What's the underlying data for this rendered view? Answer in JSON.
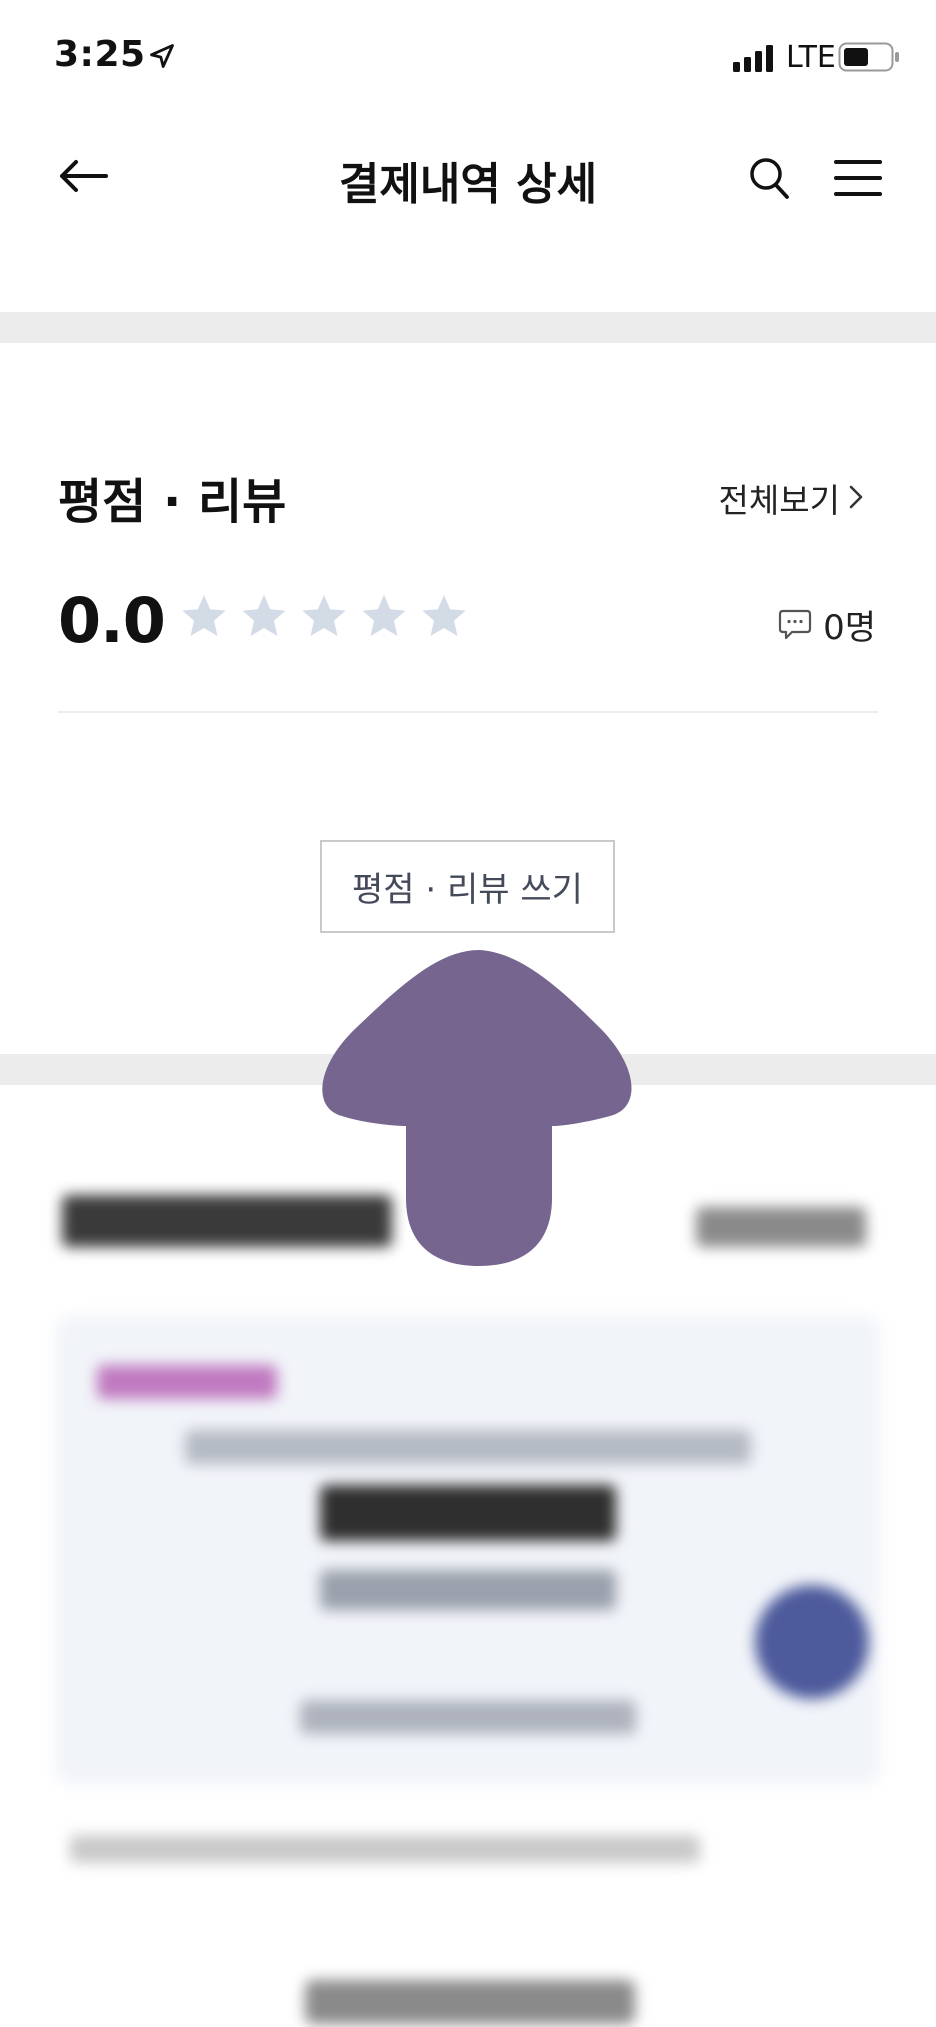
{
  "status_bar": {
    "time": "3:25",
    "network": "LTE"
  },
  "nav": {
    "title": "결제내역 상세"
  },
  "review": {
    "title": "평점 · 리뷰",
    "view_all": "전체보기",
    "score": "0.0",
    "rating_stars_filled": 0,
    "rating_stars_total": 5,
    "count": "0명",
    "write_button": "평점 · 리뷰 쓰기"
  },
  "colors": {
    "star_empty": "#d3dbe7",
    "divider_band": "#ececec",
    "overlay_arrow": "#76668f"
  }
}
